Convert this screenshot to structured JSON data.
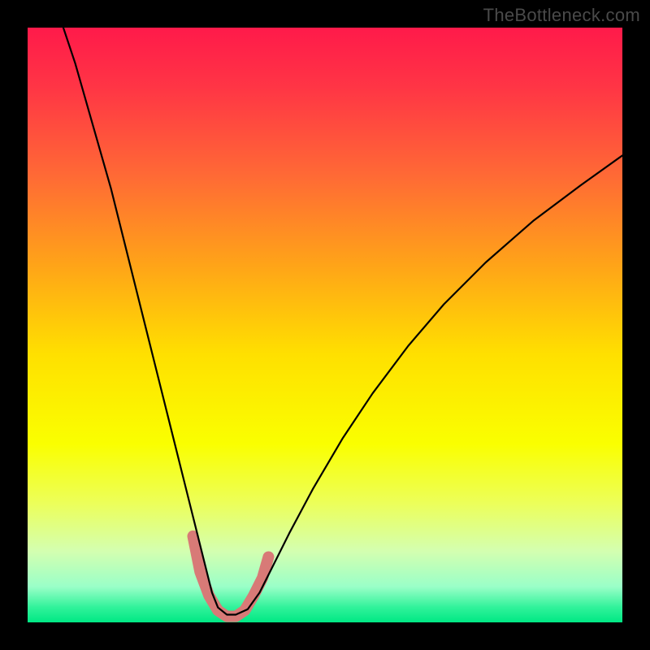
{
  "watermark": "TheBottleneck.com",
  "chart_data": {
    "type": "line",
    "title": "",
    "xlabel": "",
    "ylabel": "",
    "xlim": [
      0,
      100
    ],
    "ylim": [
      0,
      100
    ],
    "background_gradient": {
      "stops": [
        {
          "offset": 0.0,
          "color": "#ff1a4a"
        },
        {
          "offset": 0.1,
          "color": "#ff3545"
        },
        {
          "offset": 0.25,
          "color": "#ff6a35"
        },
        {
          "offset": 0.4,
          "color": "#ffa418"
        },
        {
          "offset": 0.55,
          "color": "#ffe000"
        },
        {
          "offset": 0.7,
          "color": "#faff00"
        },
        {
          "offset": 0.8,
          "color": "#ecff5a"
        },
        {
          "offset": 0.88,
          "color": "#d4ffb0"
        },
        {
          "offset": 0.94,
          "color": "#9affc8"
        },
        {
          "offset": 0.975,
          "color": "#30f29a"
        },
        {
          "offset": 1.0,
          "color": "#00e884"
        }
      ]
    },
    "series": [
      {
        "name": "bottleneck-curve",
        "color": "#000000",
        "width": 2.2,
        "x": [
          6.0,
          8.0,
          10.0,
          12.0,
          14.0,
          16.0,
          18.0,
          20.0,
          22.0,
          24.0,
          26.0,
          28.0,
          30.0,
          31.0,
          32.0,
          33.5,
          35.0,
          37.0,
          39.0,
          41.0,
          44.0,
          48.0,
          53.0,
          58.0,
          64.0,
          70.0,
          77.0,
          85.0,
          93.0,
          100.0
        ],
        "y": [
          100.0,
          94.0,
          87.0,
          80.0,
          73.0,
          65.0,
          57.0,
          49.0,
          41.0,
          33.0,
          25.0,
          17.0,
          9.0,
          5.0,
          2.5,
          1.3,
          1.3,
          2.2,
          5.0,
          9.0,
          15.0,
          22.5,
          31.0,
          38.5,
          46.5,
          53.5,
          60.5,
          67.5,
          73.5,
          78.5
        ]
      }
    ],
    "highlight_band": {
      "color": "#d87a77",
      "width": 14,
      "points_x": [
        27.8,
        29.0,
        30.5,
        32.0,
        33.5,
        35.0,
        36.5,
        38.0,
        39.5,
        40.5
      ],
      "points_y": [
        14.5,
        8.5,
        4.5,
        2.0,
        1.0,
        1.0,
        2.0,
        4.5,
        7.5,
        11.0
      ]
    }
  }
}
